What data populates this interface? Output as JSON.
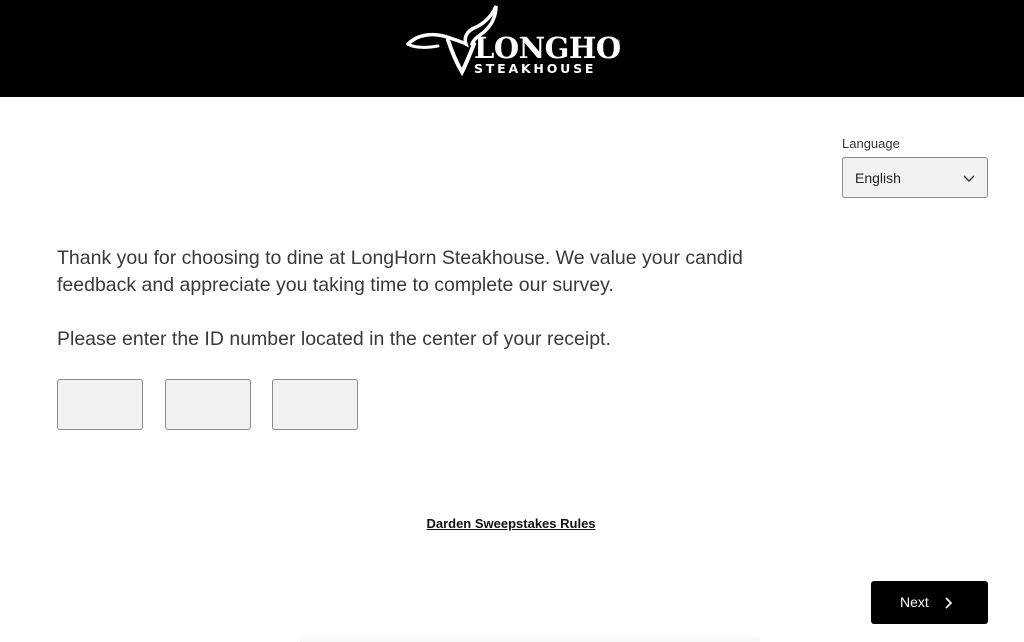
{
  "header": {
    "logo_primary": "LONGHORN",
    "logo_secondary": "STEAKHOUSE",
    "background_color": "#000000"
  },
  "language": {
    "label": "Language",
    "selected": "English"
  },
  "intro_text": "Thank you for choosing to dine at LongHorn Steakhouse. We value your candid feedback and appreciate you taking time to complete our survey.",
  "prompt_text": "Please enter the ID number located in the center of your receipt.",
  "id_fields": [
    {
      "value": ""
    },
    {
      "value": ""
    },
    {
      "value": ""
    }
  ],
  "rules_link": "Darden Sweepstakes Rules",
  "next_button": {
    "label": "Next",
    "icon": "chevron-right-icon",
    "color": "#000000"
  }
}
